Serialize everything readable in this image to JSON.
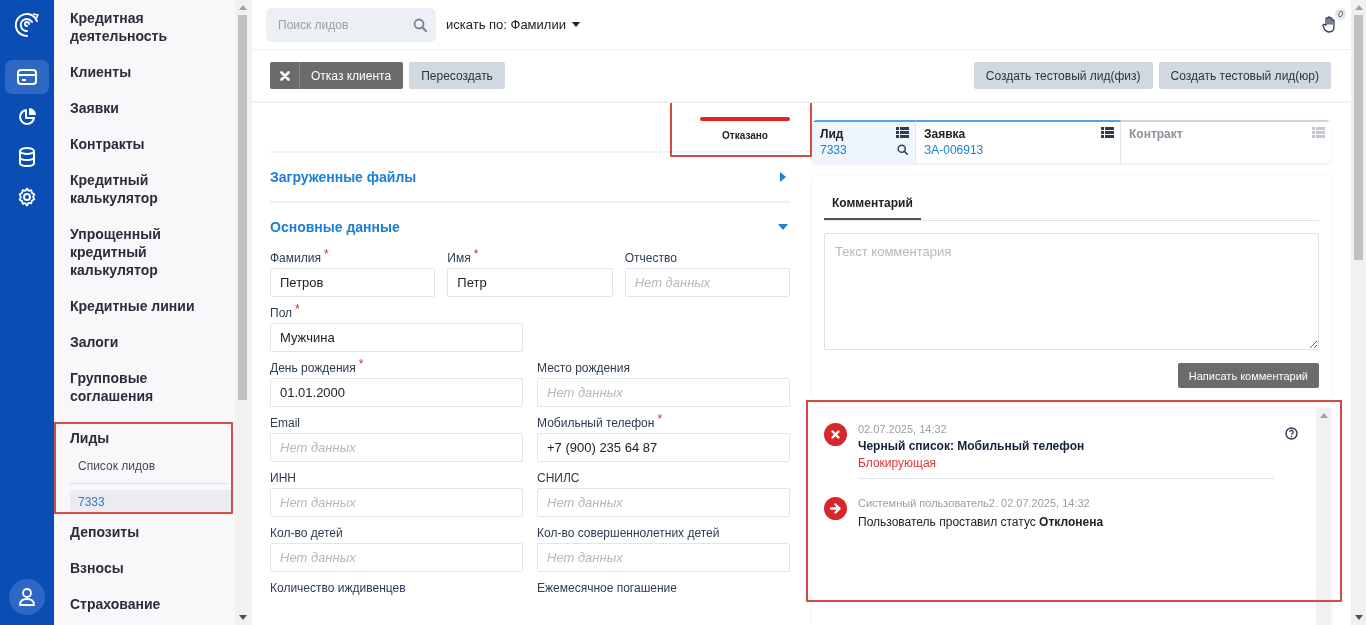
{
  "rail": {
    "items": [
      {
        "kind": "card",
        "selected": true
      },
      {
        "kind": "chart",
        "selected": false
      },
      {
        "kind": "database",
        "selected": false
      },
      {
        "kind": "settings",
        "selected": false
      }
    ]
  },
  "sidebar": {
    "items": [
      {
        "label": "Кредитная деятельность",
        "selected": false
      },
      {
        "label": "Клиенты",
        "selected": false
      },
      {
        "label": "Заявки",
        "selected": false
      },
      {
        "label": "Контракты",
        "selected": false
      },
      {
        "label": "Кредитный калькулятор",
        "selected": false
      },
      {
        "label": "Упрощенный кредитный калькулятор",
        "selected": false
      },
      {
        "label": "Кредитные линии",
        "selected": false
      },
      {
        "label": "Залоги",
        "selected": false
      },
      {
        "label": "Групповые соглашения",
        "selected": false
      },
      {
        "label": "Лиды",
        "selected": false,
        "highlighted": true,
        "children": [
          {
            "label": "Список лидов",
            "selected": false
          },
          {
            "label": "7333",
            "selected": true
          }
        ]
      },
      {
        "label": "Депозиты",
        "selected": false
      },
      {
        "label": "Взносы",
        "selected": false
      },
      {
        "label": "Страхование",
        "selected": false
      }
    ]
  },
  "topbar": {
    "search": {
      "placeholder": "Поиск лидов"
    },
    "search_by": "искать по: Фамилии",
    "notifications": "0"
  },
  "toolbar": {
    "left_buttons": [
      {
        "label": "Отказ клиента",
        "kind": "dark"
      },
      {
        "label": "Пересоздать",
        "kind": "light"
      }
    ],
    "right_buttons": [
      {
        "label": "Создать тестовый лид(физ)",
        "kind": "light"
      },
      {
        "label": "Создать тестовый лид(юр)",
        "kind": "light"
      }
    ]
  },
  "stage": {
    "label": "Отказано",
    "highlighted": true
  },
  "sections": [
    {
      "title": "Загруженные файлы",
      "expanded": false
    },
    {
      "title": "Основные данные",
      "expanded": true,
      "rows": [
        [
          {
            "label": "Фамилия",
            "required_mark": "*",
            "value": "Петров"
          },
          {
            "label": "Имя",
            "required_mark": "*",
            "value": "Петр"
          },
          {
            "label": "Отчество",
            "placeholder": "Нет данных"
          }
        ],
        [
          {
            "label": "Пол",
            "required_mark": "*",
            "value": "Мужчина"
          }
        ],
        [
          {
            "label": "День рождения",
            "required_mark": "*",
            "value": "01.01.2000"
          },
          {
            "label": "Место рождения",
            "placeholder": "Нет данных"
          }
        ],
        [
          {
            "label": "Email",
            "placeholder": "Нет данных"
          },
          {
            "label": "Мобильный телефон",
            "required_mark": "*",
            "value": "+7 (900) 235 64 87"
          }
        ],
        [
          {
            "label": "ИНН",
            "placeholder": "Нет данных"
          },
          {
            "label": "СНИЛС",
            "placeholder": "Нет данных"
          }
        ],
        [
          {
            "label": "Кол-во детей",
            "placeholder": "Нет данных"
          },
          {
            "label": "Кол-во совершеннолетних детей",
            "placeholder": "Нет данных"
          }
        ],
        [
          {
            "label": "Количество иждивенцев"
          },
          {
            "label": "Ежемесячное погашение"
          }
        ]
      ]
    }
  ],
  "record_tabs": [
    {
      "title": "Лид",
      "value": "7333",
      "selected": true,
      "disabled": false,
      "search": true
    },
    {
      "title": "Заявка",
      "value": "ЗА-006913",
      "selected": false,
      "disabled": false,
      "search": false
    },
    {
      "title": "Контракт",
      "selected": false,
      "disabled": true,
      "search": false
    }
  ],
  "comments": {
    "tabs": [
      {
        "label": "Комментарий",
        "selected": true
      }
    ],
    "placeholder": "Текст комментария",
    "button": "Написать комментарий"
  },
  "events": {
    "highlighted": true,
    "items": [
      {
        "kind": "blocklist",
        "meta": "02.07.2025, 14:32",
        "title": "Черный список: Мобильный телефон",
        "severity": "Блокирующая",
        "help": true
      },
      {
        "kind": "status",
        "meta": "Системный пользователь2. 02.07.2025, 14:32",
        "text": "Пользователь проставил статус **Отклонена**",
        "help": false
      }
    ]
  }
}
